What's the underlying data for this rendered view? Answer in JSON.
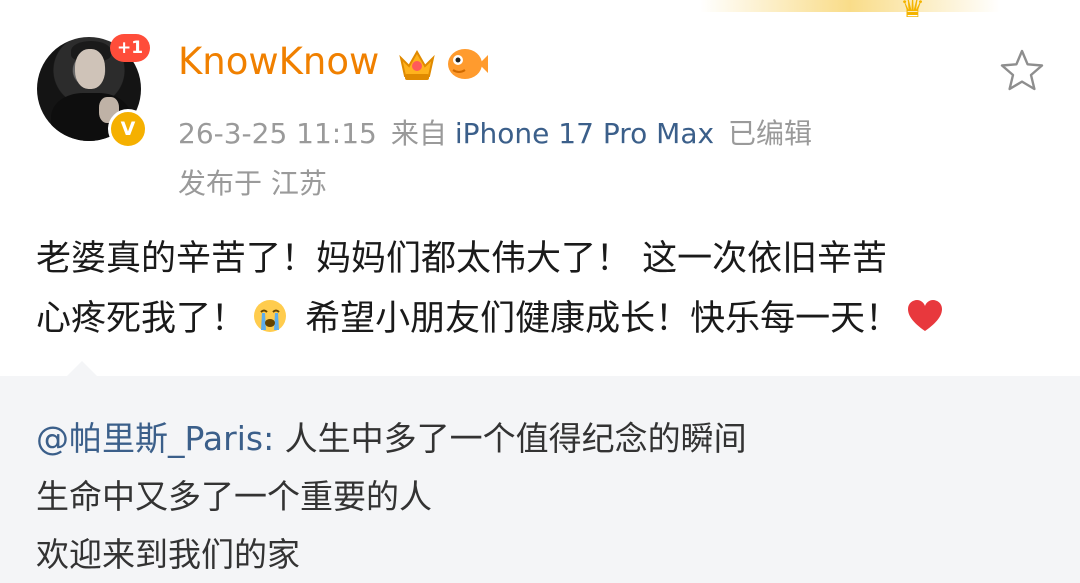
{
  "post": {
    "author": {
      "name": "KnowKnow",
      "avatar_badge": "+1",
      "verified_mark": "V"
    },
    "meta": {
      "time": "26-3-25 11:15",
      "source_prefix": "来自",
      "source_device": "iPhone 17 Pro Max",
      "edited": "已编辑"
    },
    "location": "发布于 江苏",
    "content": {
      "line1": "老婆真的辛苦了！妈妈们都太伟大了！ 这一次依旧辛苦",
      "line2_a": "心疼死我了！",
      "line2_b": " 希望小朋友们健康成长！快乐每一天！",
      "emoji_1": "crying-face-emoji",
      "emoji_2": "red-heart-emoji"
    },
    "quote": {
      "mention": "@帕里斯_Paris:",
      "line1_text": " 人生中多了一个值得纪念的瞬间",
      "line2": "生命中又多了一个重要的人",
      "line3": "欢迎来到我们的家"
    }
  },
  "icons": {
    "vip": "crown-vip-icon",
    "fish": "fish-badge-icon",
    "favorite": "star-outline-icon"
  },
  "colors": {
    "username": "#f08000",
    "link": "#3b5f8a",
    "meta_text": "#9a9a9a",
    "quote_bg": "#f4f5f7",
    "badge_red": "#ff4d3a",
    "verified_gold": "#f5b000"
  }
}
